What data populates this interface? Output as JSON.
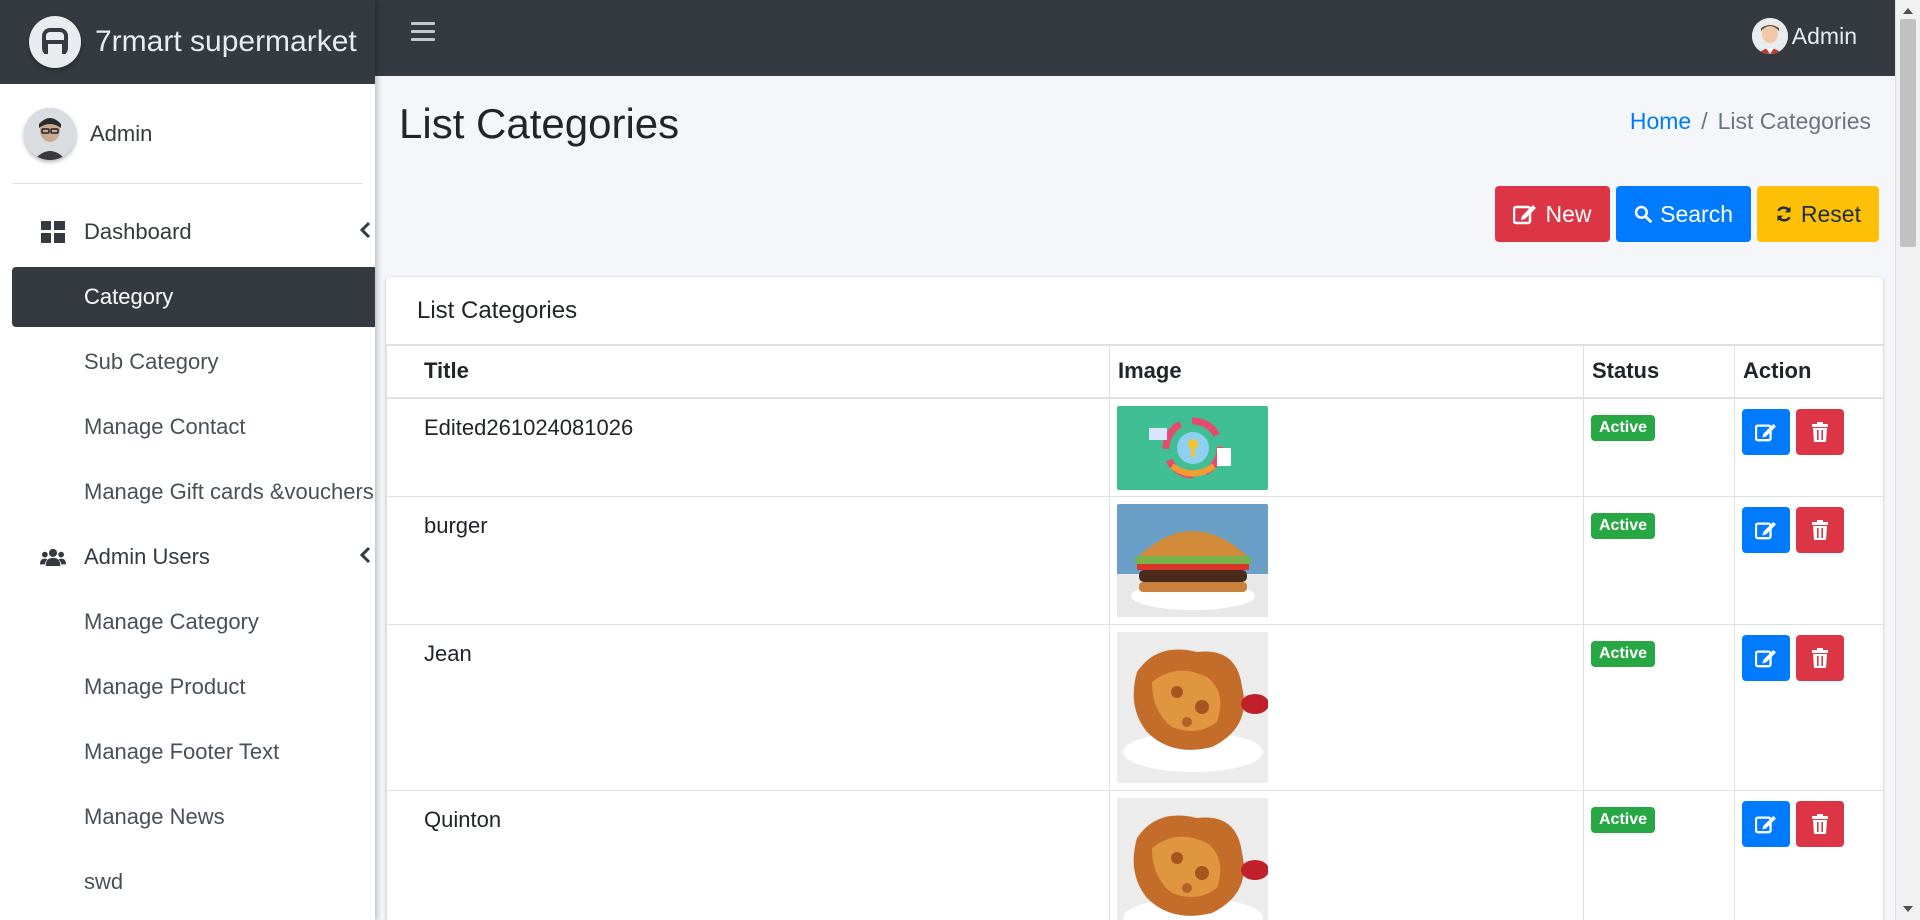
{
  "brand": {
    "name": "7rmart supermarket"
  },
  "sidebar": {
    "user": "Admin",
    "items": [
      {
        "label": "Dashboard",
        "icon": "dashboard-icon",
        "has_children": true
      },
      {
        "label": "Category",
        "active": true
      },
      {
        "label": "Sub Category"
      },
      {
        "label": "Manage Contact"
      },
      {
        "label": "Manage Gift cards &vouchers"
      },
      {
        "label": "Admin Users",
        "icon": "users-icon",
        "has_children": true
      },
      {
        "label": "Manage Category"
      },
      {
        "label": "Manage Product"
      },
      {
        "label": "Manage Footer Text"
      },
      {
        "label": "Manage News"
      },
      {
        "label": "swd"
      }
    ]
  },
  "topbar": {
    "user_label": "Admin"
  },
  "header": {
    "title": "List Categories",
    "breadcrumb": {
      "home": "Home",
      "separator": "/",
      "current": "List Categories"
    }
  },
  "buttons": {
    "new": "New",
    "search": "Search",
    "reset": "Reset"
  },
  "card": {
    "title": "List Categories",
    "columns": [
      "Title",
      "Image",
      "Status",
      "Action"
    ],
    "rows": [
      {
        "title": "Edited261024081026",
        "image": "process-cycle-illustration",
        "status": "Active"
      },
      {
        "title": "burger",
        "image": "burger-photo",
        "status": "Active"
      },
      {
        "title": "Jean",
        "image": "fried-chicken-photo",
        "status": "Active"
      },
      {
        "title": "Quinton",
        "image": "fried-chicken-photo",
        "status": "Active"
      }
    ]
  },
  "colors": {
    "dark": "#343a40",
    "primary": "#007bff",
    "danger": "#dc3545",
    "warning": "#ffc107",
    "success": "#28a745",
    "background": "#f4f6f9"
  }
}
